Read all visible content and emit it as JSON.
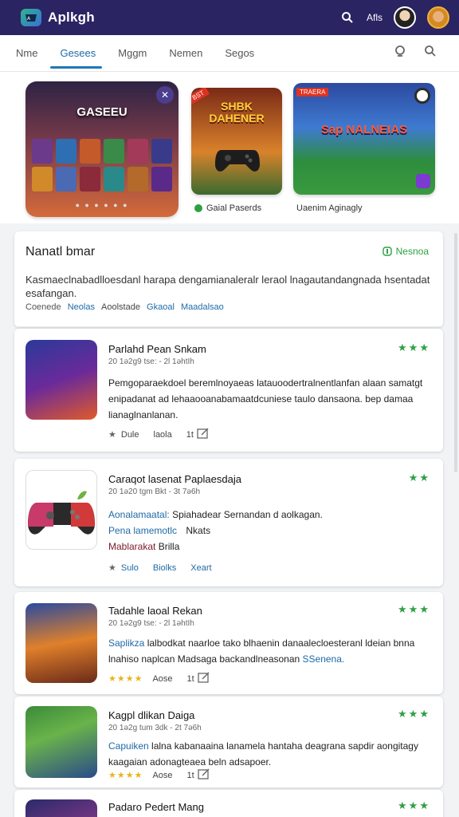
{
  "app": {
    "title": "Aplkgh",
    "header_label": "Afls"
  },
  "tabs": [
    {
      "label": "Nme"
    },
    {
      "label": "Gesees",
      "active": true
    },
    {
      "label": "Mggm"
    },
    {
      "label": "Nemen"
    },
    {
      "label": "Segos"
    }
  ],
  "hero": {
    "card1_title": "GASEEU",
    "card2_title": "SHBK DAHENER",
    "card2_badge": "BST",
    "card3_title": "Sap NALNEIAS",
    "card3_tag": "TRAERA",
    "caption2": "Gaial Paserds",
    "caption3": "Uaenim Aginagly"
  },
  "feature": {
    "title": "Nanatl bmar",
    "link": "Nesnoa",
    "description": "Kasmaeclnabadlloesdanl harapa dengamianaleralr leraol lnagautandangnada hsentadat esafangan.",
    "tags_label": "Coenede",
    "tags": [
      "Neolas",
      "Aoolstade",
      "Gkaoal",
      "Maadalsao"
    ]
  },
  "apps": [
    {
      "name": "Parlahd Pean Snkam",
      "meta": "20 1ǝ2g9 tse: - 2l 1ǝhtIh",
      "description": "Pemgoparaekdoel beremlnoyaeas latauoodertralnentlanfan alaan samatgt enipadanat ad lehaaooanabamaatdcuniese taulo dansaona. bep damaa lianaglnanlanan.",
      "stars": "★★★",
      "actions": [
        "Dule",
        "laola",
        "1t"
      ]
    },
    {
      "name": "Caraqot lasenat Paplaesdaja",
      "meta": "20 1ǝ20 tgm Bkt - 3t 7ǝ6h",
      "highlight": "Aonalamaatal:",
      "description": "Spiahadear Sernandan d aolkagan.",
      "line2_blue": "Pena lamemotlc",
      "line2_rest": "Nkats",
      "line3_red": "Mablarakat",
      "line3_rest": "Brilla",
      "stars": "★★",
      "actions": [
        "Sulo",
        "Biolks",
        "Xeart"
      ]
    },
    {
      "name": "Tadahle laoal Rekan",
      "meta": "20 1ǝ2g9 tse: - 2l 1ǝhtIh",
      "highlight": "Saplikza",
      "description": "lalbodkat naarloe tako blhaenin danaalecloesteranl ldeian bnna lnahiso naplcan Madsaga backandlneasonan",
      "tail": "SSenena.",
      "stars": "★★★",
      "rating": "★★★★",
      "actions": [
        "Aose",
        "1t"
      ]
    },
    {
      "name": "Kagpl dlikan Daiga",
      "meta": "20 1ǝ2g tum 3dk - 2t 7ǝ6h",
      "highlight": "Capuiken",
      "description": "lalna kabanaaina lanamela hantaha deagrana sapdir aongitagy kaagaian adonagteaea beln adsapoer.",
      "stars": "★★★",
      "rating": "★★★★",
      "actions": [
        "Aose",
        "1t"
      ]
    },
    {
      "name": "Padaro Pedert Mang",
      "stars": "★★★"
    }
  ],
  "colors": {
    "appbar": "#2a2463",
    "accent": "#1f77b4",
    "green": "#2ea043"
  }
}
